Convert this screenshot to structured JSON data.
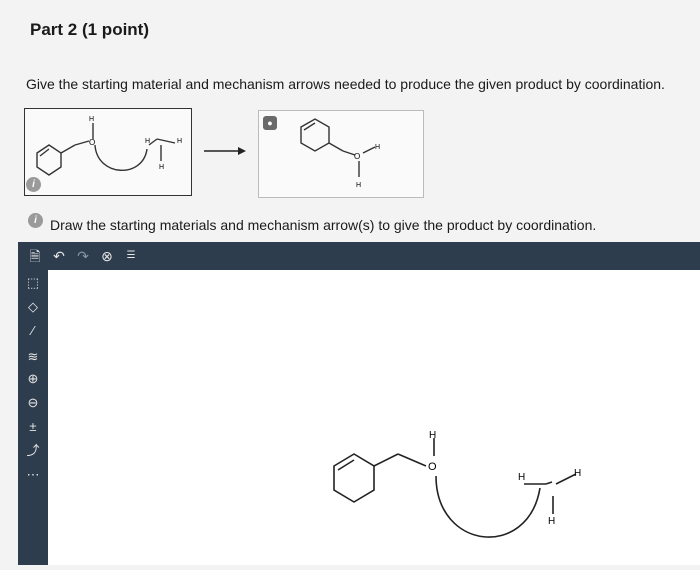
{
  "header": {
    "title": "Part 2  (1 point)"
  },
  "question": {
    "prompt": "Give the starting material and mechanism arrows needed to produce the given product by coordination."
  },
  "scheme": {
    "start_label_h_top": "H",
    "start_label_o": "O",
    "start_label_h1": "H",
    "start_label_h2": "H",
    "start_label_h3": "H",
    "product_label_o": "O",
    "product_label_h1": "H",
    "product_label_h2": "H",
    "info_badge": "i"
  },
  "instruction": {
    "badge": "i",
    "text": "Draw the starting materials and mechanism arrow(s) to give the product by coordination."
  },
  "toolbar": {
    "icons": [
      "new-document-icon",
      "undo-icon",
      "redo-icon",
      "zoom-reset-icon",
      "template-icon"
    ]
  },
  "sidebar": {
    "icons": [
      "select-icon",
      "eraser-icon",
      "bond-icon",
      "chain-icon",
      "positive-charge-icon",
      "negative-charge-icon",
      "plus-minus-icon",
      "arrow-icon",
      "lone-pair-icon"
    ]
  },
  "canvas": {
    "label_h_top": "H",
    "label_o": "O",
    "label_h1": "H",
    "label_h2": "H",
    "label_h3": "H"
  },
  "colors": {
    "toolbar": "#2e3d4d",
    "canvas": "#ffffff",
    "badge": "#9a9a9a"
  }
}
